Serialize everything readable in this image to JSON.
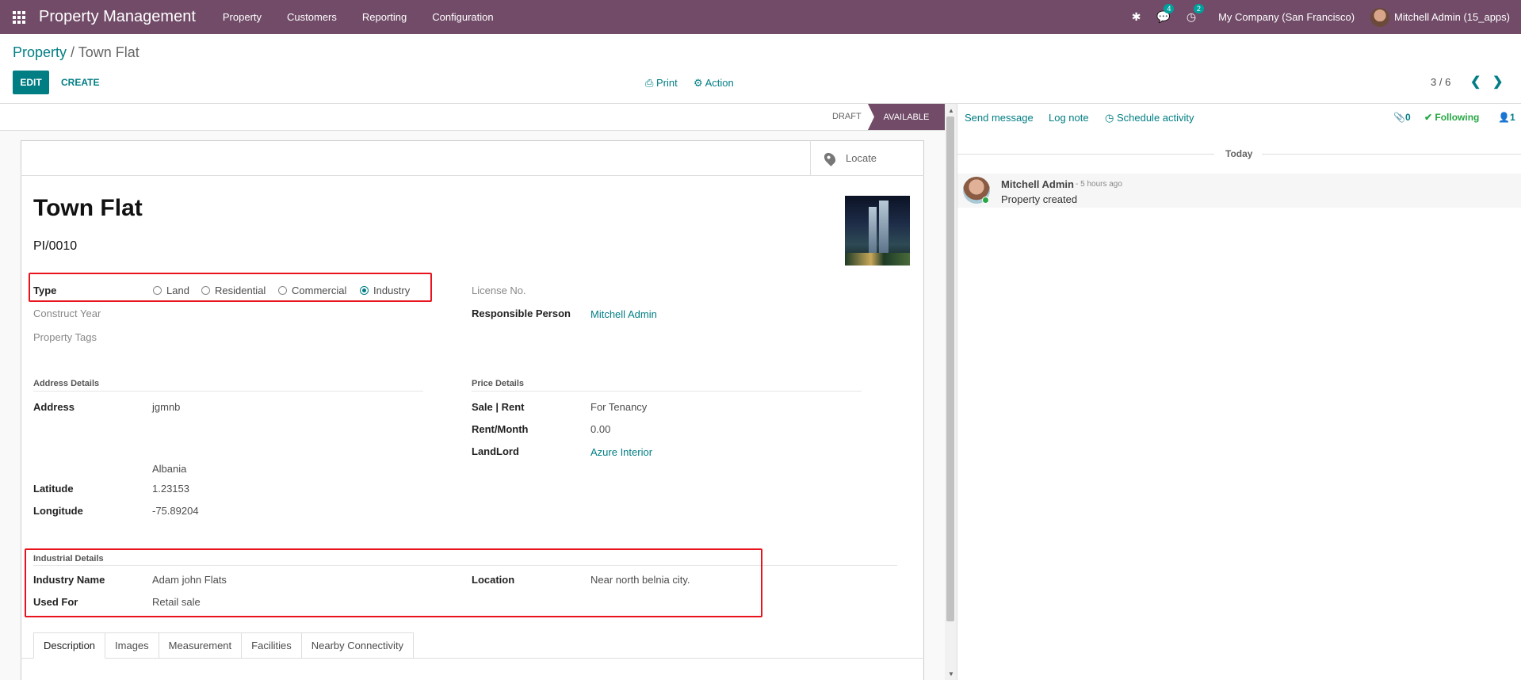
{
  "navbar": {
    "brand": "Property Management",
    "menu": [
      "Property",
      "Customers",
      "Reporting",
      "Configuration"
    ],
    "messages_badge": "4",
    "activities_badge": "2",
    "company": "My Company (San Francisco)",
    "user": "Mitchell Admin (15_apps)",
    "bg_color": "#714b67"
  },
  "breadcrumb": {
    "parent": "Property",
    "separator": " / ",
    "current": "Town Flat"
  },
  "control": {
    "edit": "EDIT",
    "create": "CREATE",
    "print": "Print",
    "action": "Action",
    "pager": "3 / 6"
  },
  "status": {
    "draft": "DRAFT",
    "available": "AVAILABLE"
  },
  "form": {
    "locate": "Locate",
    "title": "Town Flat",
    "reference": "PI/0010",
    "type_label": "Type",
    "type_options": [
      "Land",
      "Residential",
      "Commercial",
      "Industry"
    ],
    "type_selected": "Industry",
    "construct_year_label": "Construct Year",
    "property_tags_label": "Property Tags",
    "license_label": "License No.",
    "responsible_label": "Responsible Person",
    "responsible_value": "Mitchell Admin",
    "address_section": "Address Details",
    "address_label": "Address",
    "address_value": "jgmnb",
    "country_value": "Albania",
    "latitude_label": "Latitude",
    "latitude_value": "1.23153",
    "longitude_label": "Longitude",
    "longitude_value": "-75.89204",
    "price_section": "Price Details",
    "sale_rent_label": "Sale | Rent",
    "sale_rent_value": "For Tenancy",
    "rent_month_label": "Rent/Month",
    "rent_month_value": "0.00",
    "landlord_label": "LandLord",
    "landlord_value": "Azure Interior",
    "industrial_section": "Industrial Details",
    "industry_name_label": "Industry Name",
    "industry_name_value": "Adam john Flats",
    "used_for_label": "Used For",
    "used_for_value": "Retail sale",
    "location_label": "Location",
    "location_value": "Near north belnia city.",
    "tabs": [
      "Description",
      "Images",
      "Measurement",
      "Facilities",
      "Nearby Connectivity"
    ]
  },
  "chatter": {
    "send_message": "Send message",
    "log_note": "Log note",
    "schedule_activity": "Schedule activity",
    "attachments": "0",
    "following": "Following",
    "followers": "1",
    "today": "Today",
    "message": {
      "author": "Mitchell Admin",
      "time": "- 5 hours ago",
      "body": "Property created"
    }
  },
  "colors": {
    "primary": "#017e84",
    "highlight": "#e8131d",
    "purple": "#714b67"
  }
}
